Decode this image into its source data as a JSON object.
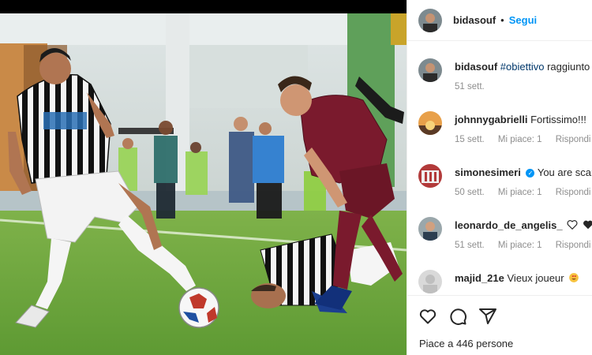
{
  "post": {
    "author": "bidasouf",
    "dot": "•",
    "follow_label": "Segui"
  },
  "comments": [
    {
      "user": "bidasouf",
      "tag": "#obiettivo",
      "text": "raggiunto",
      "time": "51 sett.",
      "likes": "",
      "reply": ""
    },
    {
      "user": "johnnygabrielli",
      "tag": "",
      "text": "Fortissimo!!!",
      "time": "15 sett.",
      "likes": "Mi piace: 1",
      "reply": "Rispondi"
    },
    {
      "user": "simonesimeri",
      "tag": "",
      "text": "You are scars",
      "time": "50 sett.",
      "likes": "Mi piace: 1",
      "reply": "Rispondi"
    },
    {
      "user": "leonardo_de_angelis_",
      "tag": "",
      "text": "",
      "time": "51 sett.",
      "likes": "Mi piace: 1",
      "reply": "Rispondi"
    },
    {
      "user": "majid_21e",
      "tag": "",
      "text": "Vieux joueur",
      "time": "",
      "likes": "",
      "reply": ""
    }
  ],
  "icons": [
    "heart-icon",
    "comment-icon",
    "share-icon"
  ],
  "likes_text": "Piace a 446 persone",
  "colors": {
    "accent": "#0095f6",
    "muted": "#8e8e8e",
    "text": "#262626"
  }
}
